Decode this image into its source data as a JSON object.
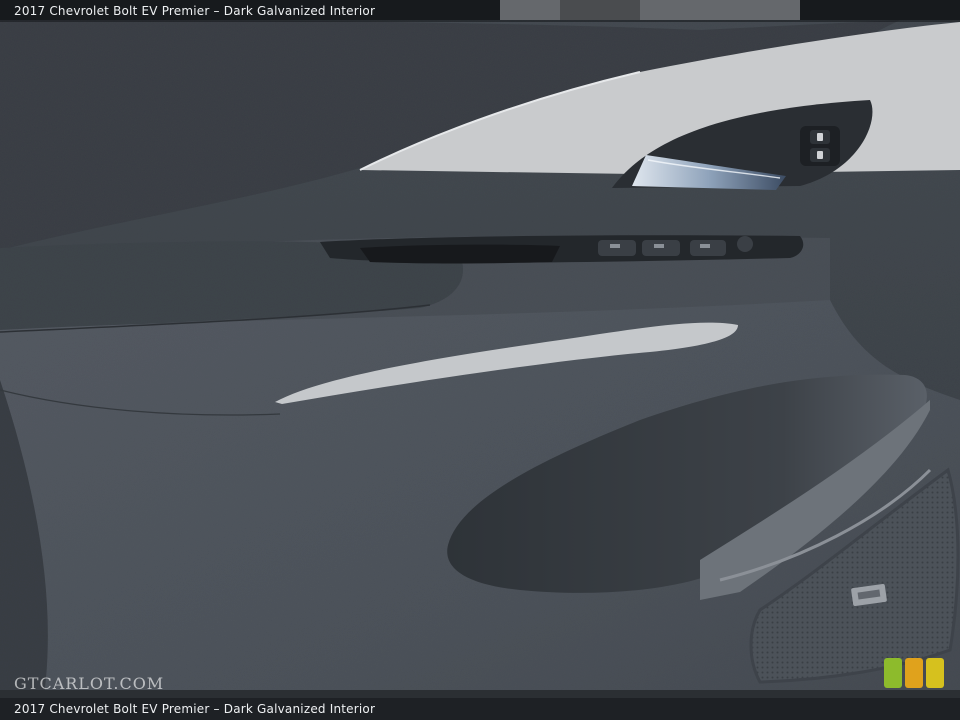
{
  "photo": {
    "caption_top": "2017 Chevrolet Bolt EV Premier – Dark Galvanized Interior",
    "caption_bottom": "2017 Chevrolet Bolt EV Premier – Dark Galvanized Interior",
    "watermark": "GTCARLOT.COM",
    "colors": {
      "door_panel": "#4a5058",
      "door_panel_dark": "#2f343a",
      "trim_light": "#c9cbcd",
      "caption_bar": "#141619"
    },
    "icons": [
      "door-handle-icon",
      "lock-switch-icon",
      "window-switch-icon",
      "speaker-grille-icon",
      "badge-bars-icon"
    ]
  }
}
